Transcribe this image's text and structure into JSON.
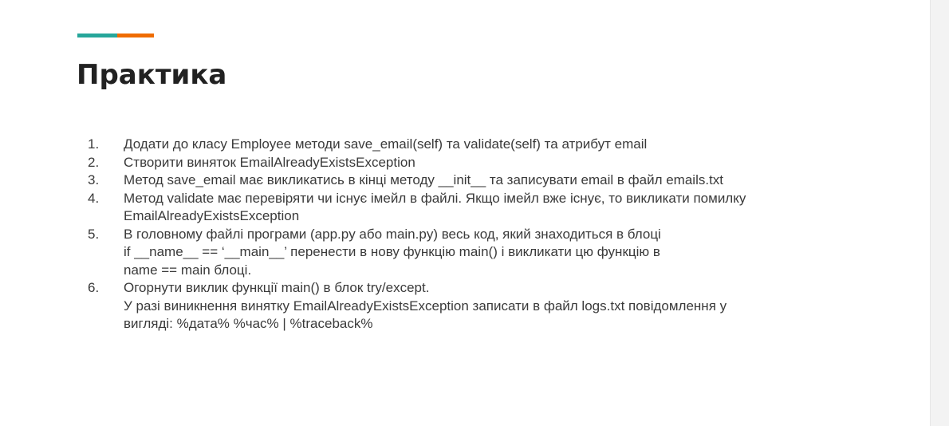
{
  "slide": {
    "title": "Практика",
    "accent_colors": [
      "#26a69a",
      "#ef6c00"
    ],
    "tasks": [
      {
        "number": "1.",
        "lines": [
          "Додати до класу Employee методи save_email(self) та validate(self) та атрибут email"
        ]
      },
      {
        "number": "2.",
        "lines": [
          "Створити виняток EmailAlreadyExistsException"
        ]
      },
      {
        "number": "3.",
        "lines": [
          "Метод save_email має викликатись в кінці методу __init__ та записувати email в файл emails.txt"
        ]
      },
      {
        "number": "4.",
        "lines": [
          "Метод validate має перевіряти чи існує імейл в файлі. Якщо імейл вже існує, то викликати помилку",
          "EmailAlreadyExistsException"
        ]
      },
      {
        "number": "5.",
        "lines": [
          "В головному файлі програми (app.py або main.py) весь код, який знаходиться в блоці",
          "if __name__ == ‘__main__’ перенести в нову функцію main() і викликати цю функцію в",
          "name == main блоці."
        ]
      },
      {
        "number": "6.",
        "lines": [
          "Огорнути виклик функції main() в блок try/except.",
          "У разі виникнення винятку EmailAlreadyExistsException записати в файл logs.txt повідомлення у",
          "вигляді: %дата% %час% | %traceback%"
        ]
      }
    ]
  }
}
